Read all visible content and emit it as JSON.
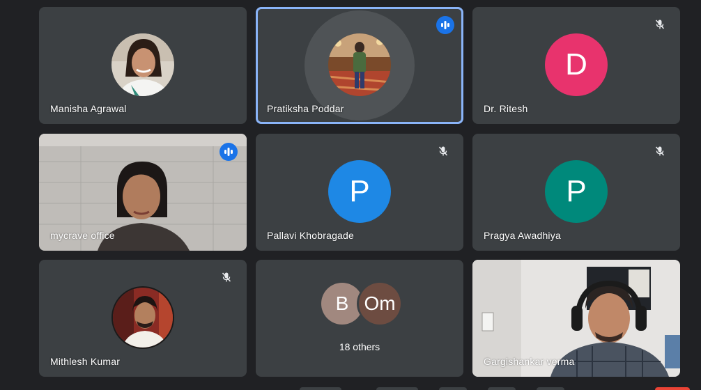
{
  "colors": {
    "background": "#202124",
    "tile": "#3c4043",
    "active_border": "#8ab4f8",
    "speaking_badge": "#1a73e8",
    "avatar_d": "#e8336d",
    "avatar_p_blue": "#1e88e5",
    "avatar_p_teal": "#00897b",
    "avatar_b": "#a1887f",
    "avatar_om": "#6d4c41",
    "end_call": "#ea4335"
  },
  "tiles": [
    {
      "name": "Manisha Agrawal",
      "avatar": "photo",
      "audio": "none"
    },
    {
      "name": "Pratiksha Poddar",
      "avatar": "photo",
      "audio": "speaking",
      "active": true
    },
    {
      "name": "Dr. Ritesh",
      "avatar_letter": "D",
      "audio": "muted"
    },
    {
      "name": "mycrave office",
      "avatar": "video",
      "audio": "speaking"
    },
    {
      "name": "Pallavi Khobragade",
      "avatar_letter": "P",
      "audio": "muted"
    },
    {
      "name": "Pragya Awadhiya",
      "avatar_letter": "P",
      "audio": "muted"
    },
    {
      "name": "Mithlesh Kumar",
      "avatar": "photo",
      "audio": "muted"
    },
    {
      "group_avatars": [
        "B",
        "Om"
      ],
      "others_label": "18 others"
    },
    {
      "name": "Gargishankar verma",
      "avatar": "video",
      "audio": "none"
    }
  ],
  "icons": {
    "muted": "mic-off-icon",
    "speaking": "audio-level-icon"
  }
}
